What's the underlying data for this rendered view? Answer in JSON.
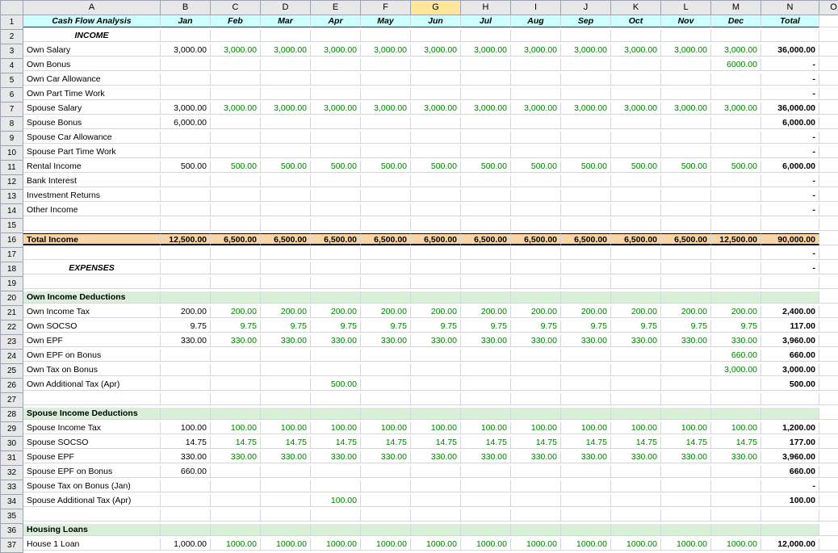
{
  "columns": [
    "",
    "A",
    "B",
    "C",
    "D",
    "E",
    "F",
    "G",
    "H",
    "I",
    "J",
    "K",
    "L",
    "M",
    "N",
    "O"
  ],
  "selected_col": "G",
  "row_count": 37,
  "header": {
    "title": "Cash Flow Analysis",
    "months": [
      "Jan",
      "Feb",
      "Mar",
      "Apr",
      "May",
      "Jun",
      "Jul",
      "Aug",
      "Sep",
      "Oct",
      "Nov",
      "Dec"
    ],
    "total": "Total"
  },
  "sections": {
    "income": "INCOME",
    "expenses": "EXPENSES",
    "own_ded": "Own Income Deductions",
    "spouse_ded": "Spouse Income Deductions",
    "housing": "Housing Loans",
    "total_income": "Total Income"
  },
  "rows": [
    {
      "r": 3,
      "label": "Own Salary",
      "vals": [
        "3,000.00",
        "3,000.00",
        "3,000.00",
        "3,000.00",
        "3,000.00",
        "3,000.00",
        "3,000.00",
        "3,000.00",
        "3,000.00",
        "3,000.00",
        "3,000.00",
        "3,000.00"
      ],
      "total": "36,000.00"
    },
    {
      "r": 4,
      "label": "Own Bonus",
      "vals": [
        "",
        "",
        "",
        "",
        "",
        "",
        "",
        "",
        "",
        "",
        "",
        "6000.00"
      ],
      "total": "-"
    },
    {
      "r": 5,
      "label": "Own Car Allowance",
      "vals": [
        "",
        "",
        "",
        "",
        "",
        "",
        "",
        "",
        "",
        "",
        "",
        ""
      ],
      "total": "-"
    },
    {
      "r": 6,
      "label": "Own Part Time Work",
      "vals": [
        "",
        "",
        "",
        "",
        "",
        "",
        "",
        "",
        "",
        "",
        "",
        ""
      ],
      "total": "-"
    },
    {
      "r": 7,
      "label": "Spouse Salary",
      "vals": [
        "3,000.00",
        "3,000.00",
        "3,000.00",
        "3,000.00",
        "3,000.00",
        "3,000.00",
        "3,000.00",
        "3,000.00",
        "3,000.00",
        "3,000.00",
        "3,000.00",
        "3,000.00"
      ],
      "total": "36,000.00"
    },
    {
      "r": 8,
      "label": "Spouse Bonus",
      "vals": [
        "6,000.00",
        "",
        "",
        "",
        "",
        "",
        "",
        "",
        "",
        "",
        "",
        ""
      ],
      "total": "6,000.00"
    },
    {
      "r": 9,
      "label": "Spouse Car Allowance",
      "vals": [
        "",
        "",
        "",
        "",
        "",
        "",
        "",
        "",
        "",
        "",
        "",
        ""
      ],
      "total": "-"
    },
    {
      "r": 10,
      "label": "Spouse Part Time Work",
      "vals": [
        "",
        "",
        "",
        "",
        "",
        "",
        "",
        "",
        "",
        "",
        "",
        ""
      ],
      "total": "-"
    },
    {
      "r": 11,
      "label": "Rental Income",
      "vals": [
        "500.00",
        "500.00",
        "500.00",
        "500.00",
        "500.00",
        "500.00",
        "500.00",
        "500.00",
        "500.00",
        "500.00",
        "500.00",
        "500.00"
      ],
      "total": "6,000.00"
    },
    {
      "r": 12,
      "label": "Bank Interest",
      "vals": [
        "",
        "",
        "",
        "",
        "",
        "",
        "",
        "",
        "",
        "",
        "",
        ""
      ],
      "total": "-"
    },
    {
      "r": 13,
      "label": "Investment Returns",
      "vals": [
        "",
        "",
        "",
        "",
        "",
        "",
        "",
        "",
        "",
        "",
        "",
        ""
      ],
      "total": "-"
    },
    {
      "r": 14,
      "label": "Other Income",
      "vals": [
        "",
        "",
        "",
        "",
        "",
        "",
        "",
        "",
        "",
        "",
        "",
        ""
      ],
      "total": "-"
    },
    {
      "r": 16,
      "label": "Total Income",
      "vals": [
        "12,500.00",
        "6,500.00",
        "6,500.00",
        "6,500.00",
        "6,500.00",
        "6,500.00",
        "6,500.00",
        "6,500.00",
        "6,500.00",
        "6,500.00",
        "6,500.00",
        "12,500.00"
      ],
      "total": "90,000.00"
    },
    {
      "r": 21,
      "label": "Own Income Tax",
      "vals": [
        "200.00",
        "200.00",
        "200.00",
        "200.00",
        "200.00",
        "200.00",
        "200.00",
        "200.00",
        "200.00",
        "200.00",
        "200.00",
        "200.00"
      ],
      "total": "2,400.00"
    },
    {
      "r": 22,
      "label": "Own SOCSO",
      "vals": [
        "9.75",
        "9.75",
        "9.75",
        "9.75",
        "9.75",
        "9.75",
        "9.75",
        "9.75",
        "9.75",
        "9.75",
        "9.75",
        "9.75"
      ],
      "total": "117.00"
    },
    {
      "r": 23,
      "label": "Own EPF",
      "vals": [
        "330.00",
        "330.00",
        "330.00",
        "330.00",
        "330.00",
        "330.00",
        "330.00",
        "330.00",
        "330.00",
        "330.00",
        "330.00",
        "330.00"
      ],
      "total": "3,960.00"
    },
    {
      "r": 24,
      "label": "Own EPF on Bonus",
      "vals": [
        "",
        "",
        "",
        "",
        "",
        "",
        "",
        "",
        "",
        "",
        "",
        "660.00"
      ],
      "total": "660.00"
    },
    {
      "r": 25,
      "label": "Own Tax on Bonus",
      "vals": [
        "",
        "",
        "",
        "",
        "",
        "",
        "",
        "",
        "",
        "",
        "",
        "3,000.00"
      ],
      "total": "3,000.00"
    },
    {
      "r": 26,
      "label": "Own Additional Tax (Apr)",
      "vals": [
        "",
        "",
        "",
        "500.00",
        "",
        "",
        "",
        "",
        "",
        "",
        "",
        ""
      ],
      "total": "500.00"
    },
    {
      "r": 29,
      "label": "Spouse Income Tax",
      "vals": [
        "100.00",
        "100.00",
        "100.00",
        "100.00",
        "100.00",
        "100.00",
        "100.00",
        "100.00",
        "100.00",
        "100.00",
        "100.00",
        "100.00"
      ],
      "total": "1,200.00"
    },
    {
      "r": 30,
      "label": "Spouse SOCSO",
      "vals": [
        "14.75",
        "14.75",
        "14.75",
        "14.75",
        "14.75",
        "14.75",
        "14.75",
        "14.75",
        "14.75",
        "14.75",
        "14.75",
        "14.75"
      ],
      "total": "177.00"
    },
    {
      "r": 31,
      "label": "Spouse EPF",
      "vals": [
        "330.00",
        "330.00",
        "330.00",
        "330.00",
        "330.00",
        "330.00",
        "330.00",
        "330.00",
        "330.00",
        "330.00",
        "330.00",
        "330.00"
      ],
      "total": "3,960.00"
    },
    {
      "r": 32,
      "label": "Spouse EPF on Bonus",
      "vals": [
        "660.00",
        "",
        "",
        "",
        "",
        "",
        "",
        "",
        "",
        "",
        "",
        ""
      ],
      "total": "660.00"
    },
    {
      "r": 33,
      "label": "Spouse Tax on Bonus (Jan)",
      "vals": [
        "",
        "",
        "",
        "",
        "",
        "",
        "",
        "",
        "",
        "",
        "",
        ""
      ],
      "total": "-"
    },
    {
      "r": 34,
      "label": "Spouse Additional Tax (Apr)",
      "vals": [
        "",
        "",
        "",
        "100.00",
        "",
        "",
        "",
        "",
        "",
        "",
        "",
        ""
      ],
      "total": "100.00"
    },
    {
      "r": 37,
      "label": "House 1 Loan",
      "vals": [
        "1,000.00",
        "1000.00",
        "1000.00",
        "1000.00",
        "1000.00",
        "1000.00",
        "1000.00",
        "1000.00",
        "1000.00",
        "1000.00",
        "1000.00",
        "1000.00"
      ],
      "total": "12,000.00"
    }
  ],
  "chart_data": {
    "type": "table",
    "title": "Cash Flow Analysis",
    "categories": [
      "Jan",
      "Feb",
      "Mar",
      "Apr",
      "May",
      "Jun",
      "Jul",
      "Aug",
      "Sep",
      "Oct",
      "Nov",
      "Dec",
      "Total"
    ],
    "series": [
      {
        "name": "Own Salary",
        "values": [
          3000,
          3000,
          3000,
          3000,
          3000,
          3000,
          3000,
          3000,
          3000,
          3000,
          3000,
          3000,
          36000
        ]
      },
      {
        "name": "Own Bonus",
        "values": [
          null,
          null,
          null,
          null,
          null,
          null,
          null,
          null,
          null,
          null,
          null,
          6000,
          null
        ]
      },
      {
        "name": "Spouse Salary",
        "values": [
          3000,
          3000,
          3000,
          3000,
          3000,
          3000,
          3000,
          3000,
          3000,
          3000,
          3000,
          3000,
          36000
        ]
      },
      {
        "name": "Spouse Bonus",
        "values": [
          6000,
          null,
          null,
          null,
          null,
          null,
          null,
          null,
          null,
          null,
          null,
          null,
          6000
        ]
      },
      {
        "name": "Rental Income",
        "values": [
          500,
          500,
          500,
          500,
          500,
          500,
          500,
          500,
          500,
          500,
          500,
          500,
          6000
        ]
      },
      {
        "name": "Total Income",
        "values": [
          12500,
          6500,
          6500,
          6500,
          6500,
          6500,
          6500,
          6500,
          6500,
          6500,
          6500,
          12500,
          90000
        ]
      },
      {
        "name": "Own Income Tax",
        "values": [
          200,
          200,
          200,
          200,
          200,
          200,
          200,
          200,
          200,
          200,
          200,
          200,
          2400
        ]
      },
      {
        "name": "Own SOCSO",
        "values": [
          9.75,
          9.75,
          9.75,
          9.75,
          9.75,
          9.75,
          9.75,
          9.75,
          9.75,
          9.75,
          9.75,
          9.75,
          117
        ]
      },
      {
        "name": "Own EPF",
        "values": [
          330,
          330,
          330,
          330,
          330,
          330,
          330,
          330,
          330,
          330,
          330,
          330,
          3960
        ]
      },
      {
        "name": "Own EPF on Bonus",
        "values": [
          null,
          null,
          null,
          null,
          null,
          null,
          null,
          null,
          null,
          null,
          null,
          660,
          660
        ]
      },
      {
        "name": "Own Tax on Bonus",
        "values": [
          null,
          null,
          null,
          null,
          null,
          null,
          null,
          null,
          null,
          null,
          null,
          3000,
          3000
        ]
      },
      {
        "name": "Own Additional Tax (Apr)",
        "values": [
          null,
          null,
          null,
          500,
          null,
          null,
          null,
          null,
          null,
          null,
          null,
          null,
          500
        ]
      },
      {
        "name": "Spouse Income Tax",
        "values": [
          100,
          100,
          100,
          100,
          100,
          100,
          100,
          100,
          100,
          100,
          100,
          100,
          1200
        ]
      },
      {
        "name": "Spouse SOCSO",
        "values": [
          14.75,
          14.75,
          14.75,
          14.75,
          14.75,
          14.75,
          14.75,
          14.75,
          14.75,
          14.75,
          14.75,
          14.75,
          177
        ]
      },
      {
        "name": "Spouse EPF",
        "values": [
          330,
          330,
          330,
          330,
          330,
          330,
          330,
          330,
          330,
          330,
          330,
          330,
          3960
        ]
      },
      {
        "name": "Spouse EPF on Bonus",
        "values": [
          660,
          null,
          null,
          null,
          null,
          null,
          null,
          null,
          null,
          null,
          null,
          null,
          660
        ]
      },
      {
        "name": "Spouse Additional Tax (Apr)",
        "values": [
          null,
          null,
          null,
          100,
          null,
          null,
          null,
          null,
          null,
          null,
          null,
          null,
          100
        ]
      },
      {
        "name": "House 1 Loan",
        "values": [
          1000,
          1000,
          1000,
          1000,
          1000,
          1000,
          1000,
          1000,
          1000,
          1000,
          1000,
          1000,
          12000
        ]
      }
    ]
  }
}
